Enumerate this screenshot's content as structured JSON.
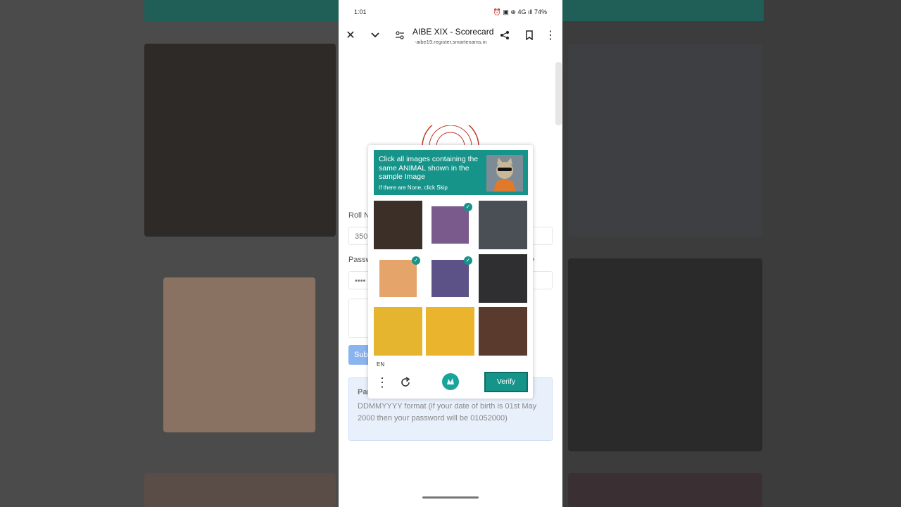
{
  "status_bar": {
    "time": "1:01",
    "icons_text": "⏰ ▣ ⊕ 4G ıll 74%"
  },
  "browser": {
    "title": "AIBE XIX - Scorecard",
    "url": "-aibe19.register.smartexams.in"
  },
  "form": {
    "roll_label": "Roll N",
    "roll_value": "350",
    "password_label": "Passw",
    "password_value": "••••",
    "submit_label": "Sub",
    "info_title": "Par",
    "info_text": "DDMMYYYY format (if your date of birth is 01st May 2000 then your password will be 01052000)"
  },
  "captcha": {
    "prompt": "Click all images containing the same ANIMAL shown in the sample Image",
    "sub": "If there are None, click Skip",
    "language": "EN",
    "verify_label": "Verify",
    "tiles": [
      {
        "name": "tile-dog-1",
        "selected": false,
        "color": "#3b2f28"
      },
      {
        "name": "tile-cat-1",
        "selected": true,
        "color": "#7a5a8c"
      },
      {
        "name": "tile-dog-2",
        "selected": false,
        "color": "#4a4e55"
      },
      {
        "name": "tile-cat-2",
        "selected": true,
        "color": "#e4a46a"
      },
      {
        "name": "tile-cat-3",
        "selected": true,
        "color": "#5d5287"
      },
      {
        "name": "tile-dog-3",
        "selected": false,
        "color": "#2f2f31"
      },
      {
        "name": "tile-hardhat-1",
        "selected": false,
        "color": "#e6b530"
      },
      {
        "name": "tile-hardhat-2",
        "selected": false,
        "color": "#eab52c"
      },
      {
        "name": "tile-shoes",
        "selected": false,
        "color": "#5b3a2e"
      }
    ]
  }
}
